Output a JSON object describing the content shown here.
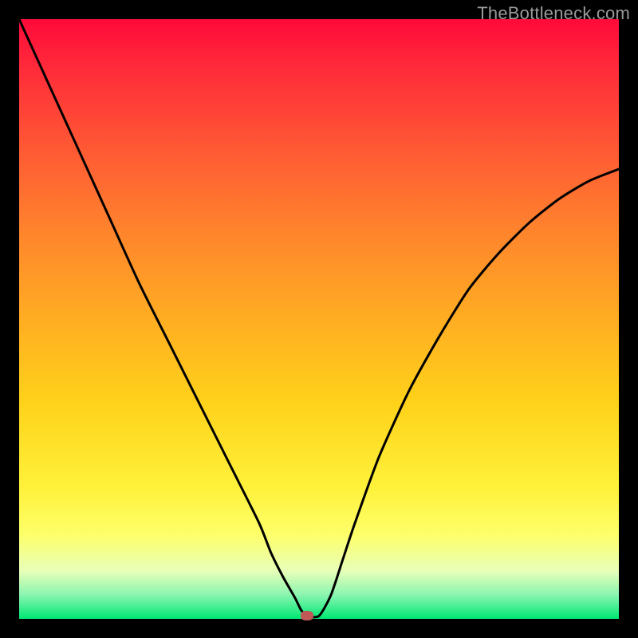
{
  "watermark": "TheBottleneck.com",
  "chart_data": {
    "type": "line",
    "title": "",
    "xlabel": "",
    "ylabel": "",
    "xlim": [
      0,
      100
    ],
    "ylim": [
      0,
      100
    ],
    "x": [
      0,
      5,
      10,
      15,
      20,
      25,
      30,
      35,
      40,
      42,
      44,
      46,
      47,
      48,
      50,
      52,
      54,
      56,
      60,
      65,
      70,
      75,
      80,
      85,
      90,
      95,
      100
    ],
    "values": [
      100,
      89,
      78,
      67,
      56,
      46,
      36,
      26,
      16,
      11,
      7,
      3.5,
      1.5,
      0.5,
      0.5,
      4,
      10,
      16,
      27,
      38,
      47,
      55,
      61,
      66,
      70,
      73,
      75
    ],
    "annotations": [
      {
        "type": "marker",
        "x": 48,
        "y": 0.5,
        "shape": "rounded-rect",
        "color": "#c05858"
      }
    ],
    "gradient_stops": [
      {
        "pos": 0,
        "color": "#ff0a3a"
      },
      {
        "pos": 8,
        "color": "#ff2a3a"
      },
      {
        "pos": 22,
        "color": "#ff5a34"
      },
      {
        "pos": 36,
        "color": "#ff862c"
      },
      {
        "pos": 50,
        "color": "#ffad22"
      },
      {
        "pos": 64,
        "color": "#ffd21a"
      },
      {
        "pos": 78,
        "color": "#fff13a"
      },
      {
        "pos": 86,
        "color": "#fdff6a"
      },
      {
        "pos": 92,
        "color": "#e8ffb8"
      },
      {
        "pos": 96,
        "color": "#8af5b0"
      },
      {
        "pos": 100,
        "color": "#00e874"
      }
    ]
  }
}
